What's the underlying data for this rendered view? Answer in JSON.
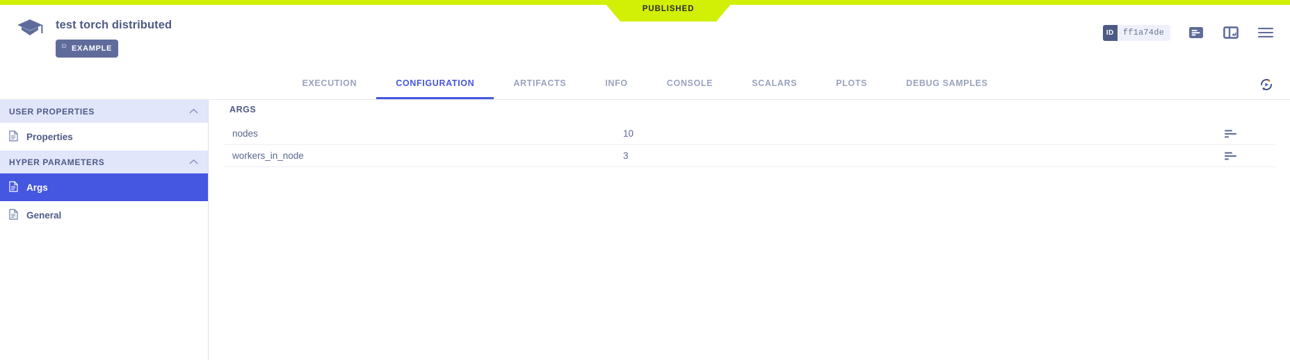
{
  "ribbon": {
    "status_label": "PUBLISHED",
    "color": "#d2f005"
  },
  "header": {
    "logo_icon": "graduation-cap-icon",
    "title": "test torch distributed",
    "badge": {
      "icon": "puzzle-piece-icon",
      "label": "EXAMPLE"
    },
    "id_chip": {
      "tag": "ID",
      "value": "ff1a74de"
    },
    "icons": [
      {
        "name": "log-panel-icon"
      },
      {
        "name": "plot-panel-icon"
      },
      {
        "name": "hamburger-menu-icon"
      }
    ]
  },
  "tabs": {
    "active": "CONFIGURATION",
    "items": [
      {
        "label": "EXECUTION"
      },
      {
        "label": "CONFIGURATION"
      },
      {
        "label": "ARTIFACTS"
      },
      {
        "label": "INFO"
      },
      {
        "label": "CONSOLE"
      },
      {
        "label": "SCALARS"
      },
      {
        "label": "PLOTS"
      },
      {
        "label": "DEBUG SAMPLES"
      }
    ],
    "refresh_icon": "auto-refresh-icon"
  },
  "sidebar": {
    "sections": [
      {
        "title": "USER PROPERTIES",
        "collapse_icon": "chevron-up-icon",
        "items": [
          {
            "label": "Properties",
            "icon": "document-icon",
            "selected": false
          }
        ]
      },
      {
        "title": "HYPER PARAMETERS",
        "collapse_icon": "chevron-up-icon",
        "items": [
          {
            "label": "Args",
            "icon": "document-icon",
            "selected": true
          },
          {
            "label": "General",
            "icon": "document-icon",
            "selected": false
          }
        ]
      }
    ]
  },
  "main": {
    "section_title": "ARGS",
    "rows": [
      {
        "key": "nodes",
        "value": "10",
        "action_icon": "bar-list-icon"
      },
      {
        "key": "workers_in_node",
        "value": "3",
        "action_icon": "bar-list-icon"
      }
    ]
  },
  "colors": {
    "accent": "#4556e0",
    "ribbon": "#d2f005",
    "text_primary": "#4d5a86",
    "text_muted": "#9aa3bd",
    "section_bg": "#e2e6fb"
  }
}
